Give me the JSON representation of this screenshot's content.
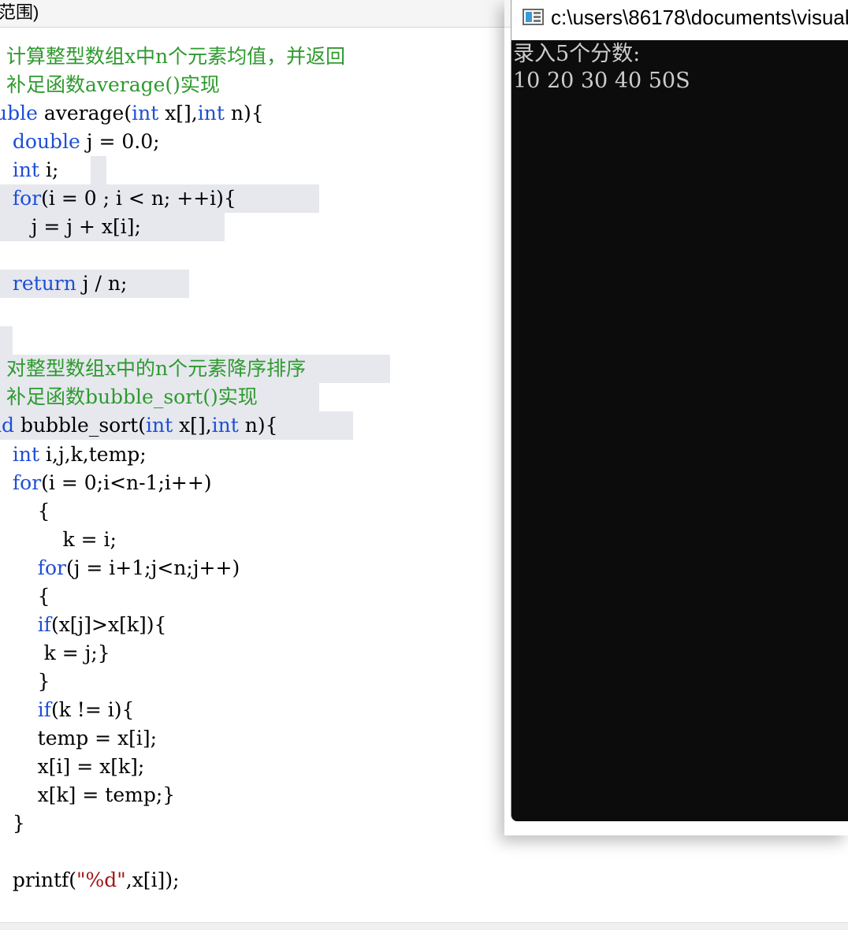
{
  "editor": {
    "header_label": "范围)",
    "lines": [
      [
        {
          "t": " 计算整型数组x中n个元素均值，并返回",
          "c": "cm"
        }
      ],
      [
        {
          "t": " 补足函数average()实现",
          "c": "cm"
        }
      ],
      [
        {
          "t": "uble",
          "c": "kw"
        },
        {
          "t": " average(",
          "c": ""
        },
        {
          "t": "int",
          "c": "kw"
        },
        {
          "t": " x[],",
          "c": ""
        },
        {
          "t": "int",
          "c": "kw"
        },
        {
          "t": " n){",
          "c": ""
        }
      ],
      [
        {
          "t": "  ",
          "c": ""
        },
        {
          "t": "double",
          "c": "kw"
        },
        {
          "t": " j = 0.0;",
          "c": ""
        }
      ],
      [
        {
          "t": "  ",
          "c": ""
        },
        {
          "t": "int",
          "c": "kw"
        },
        {
          "t": " i;",
          "c": ""
        }
      ],
      [
        {
          "t": "  ",
          "c": ""
        },
        {
          "t": "for",
          "c": "kw"
        },
        {
          "t": "(i = 0 ; i < n; ++i){",
          "c": ""
        }
      ],
      [
        {
          "t": "     j = j + x[i];",
          "c": ""
        }
      ],
      [],
      [
        {
          "t": "  ",
          "c": ""
        },
        {
          "t": "return",
          "c": "kw"
        },
        {
          "t": " j / n;",
          "c": ""
        }
      ],
      [],
      [],
      [
        {
          "t": " 对整型数组x中的n个元素降序排序",
          "c": "cm"
        }
      ],
      [
        {
          "t": " 补足函数bubble_sort()实现",
          "c": "cm"
        }
      ],
      [
        {
          "t": "id",
          "c": "kw"
        },
        {
          "t": " bubble_sort(",
          "c": ""
        },
        {
          "t": "int",
          "c": "kw"
        },
        {
          "t": " x[],",
          "c": ""
        },
        {
          "t": "int",
          "c": "kw"
        },
        {
          "t": " n){",
          "c": ""
        }
      ],
      [
        {
          "t": "  ",
          "c": ""
        },
        {
          "t": "int",
          "c": "kw"
        },
        {
          "t": " i,j,k,temp;",
          "c": ""
        }
      ],
      [
        {
          "t": "  ",
          "c": ""
        },
        {
          "t": "for",
          "c": "kw"
        },
        {
          "t": "(i = 0;i<n-1;i++)",
          "c": ""
        }
      ],
      [
        {
          "t": "      {",
          "c": ""
        }
      ],
      [
        {
          "t": "          k = i;",
          "c": ""
        }
      ],
      [
        {
          "t": "      ",
          "c": ""
        },
        {
          "t": "for",
          "c": "kw"
        },
        {
          "t": "(j = i+1;j<n;j++)",
          "c": ""
        }
      ],
      [
        {
          "t": "      {",
          "c": ""
        }
      ],
      [
        {
          "t": "      ",
          "c": ""
        },
        {
          "t": "if",
          "c": "kw"
        },
        {
          "t": "(x[j]>x[k]){",
          "c": ""
        }
      ],
      [
        {
          "t": "       k = j;}",
          "c": ""
        }
      ],
      [
        {
          "t": "      }",
          "c": ""
        }
      ],
      [
        {
          "t": "      ",
          "c": ""
        },
        {
          "t": "if",
          "c": "kw"
        },
        {
          "t": "(k != i){",
          "c": ""
        }
      ],
      [
        {
          "t": "      temp = x[i];",
          "c": ""
        }
      ],
      [
        {
          "t": "      x[i] = x[k];",
          "c": ""
        }
      ],
      [
        {
          "t": "      x[k] = temp;}",
          "c": ""
        }
      ],
      [
        {
          "t": "  }",
          "c": ""
        }
      ],
      [],
      [
        {
          "t": "  printf(",
          "c": ""
        },
        {
          "t": "\"%d\"",
          "c": "str"
        },
        {
          "t": ",x[i]);",
          "c": ""
        }
      ]
    ]
  },
  "console": {
    "title": "c:\\users\\86178\\documents\\visual",
    "icon": "console-window-icon",
    "output_lines": [
      "录入5个分数:",
      "10 20 30 40 50S"
    ],
    "colors": {
      "background": "#0c0c0c",
      "text": "#cccccc"
    }
  },
  "colors": {
    "keyword": "#1f4fd6",
    "comment": "#2e9a2e",
    "string": "#a31515",
    "highlight": "#e6e8ee"
  }
}
